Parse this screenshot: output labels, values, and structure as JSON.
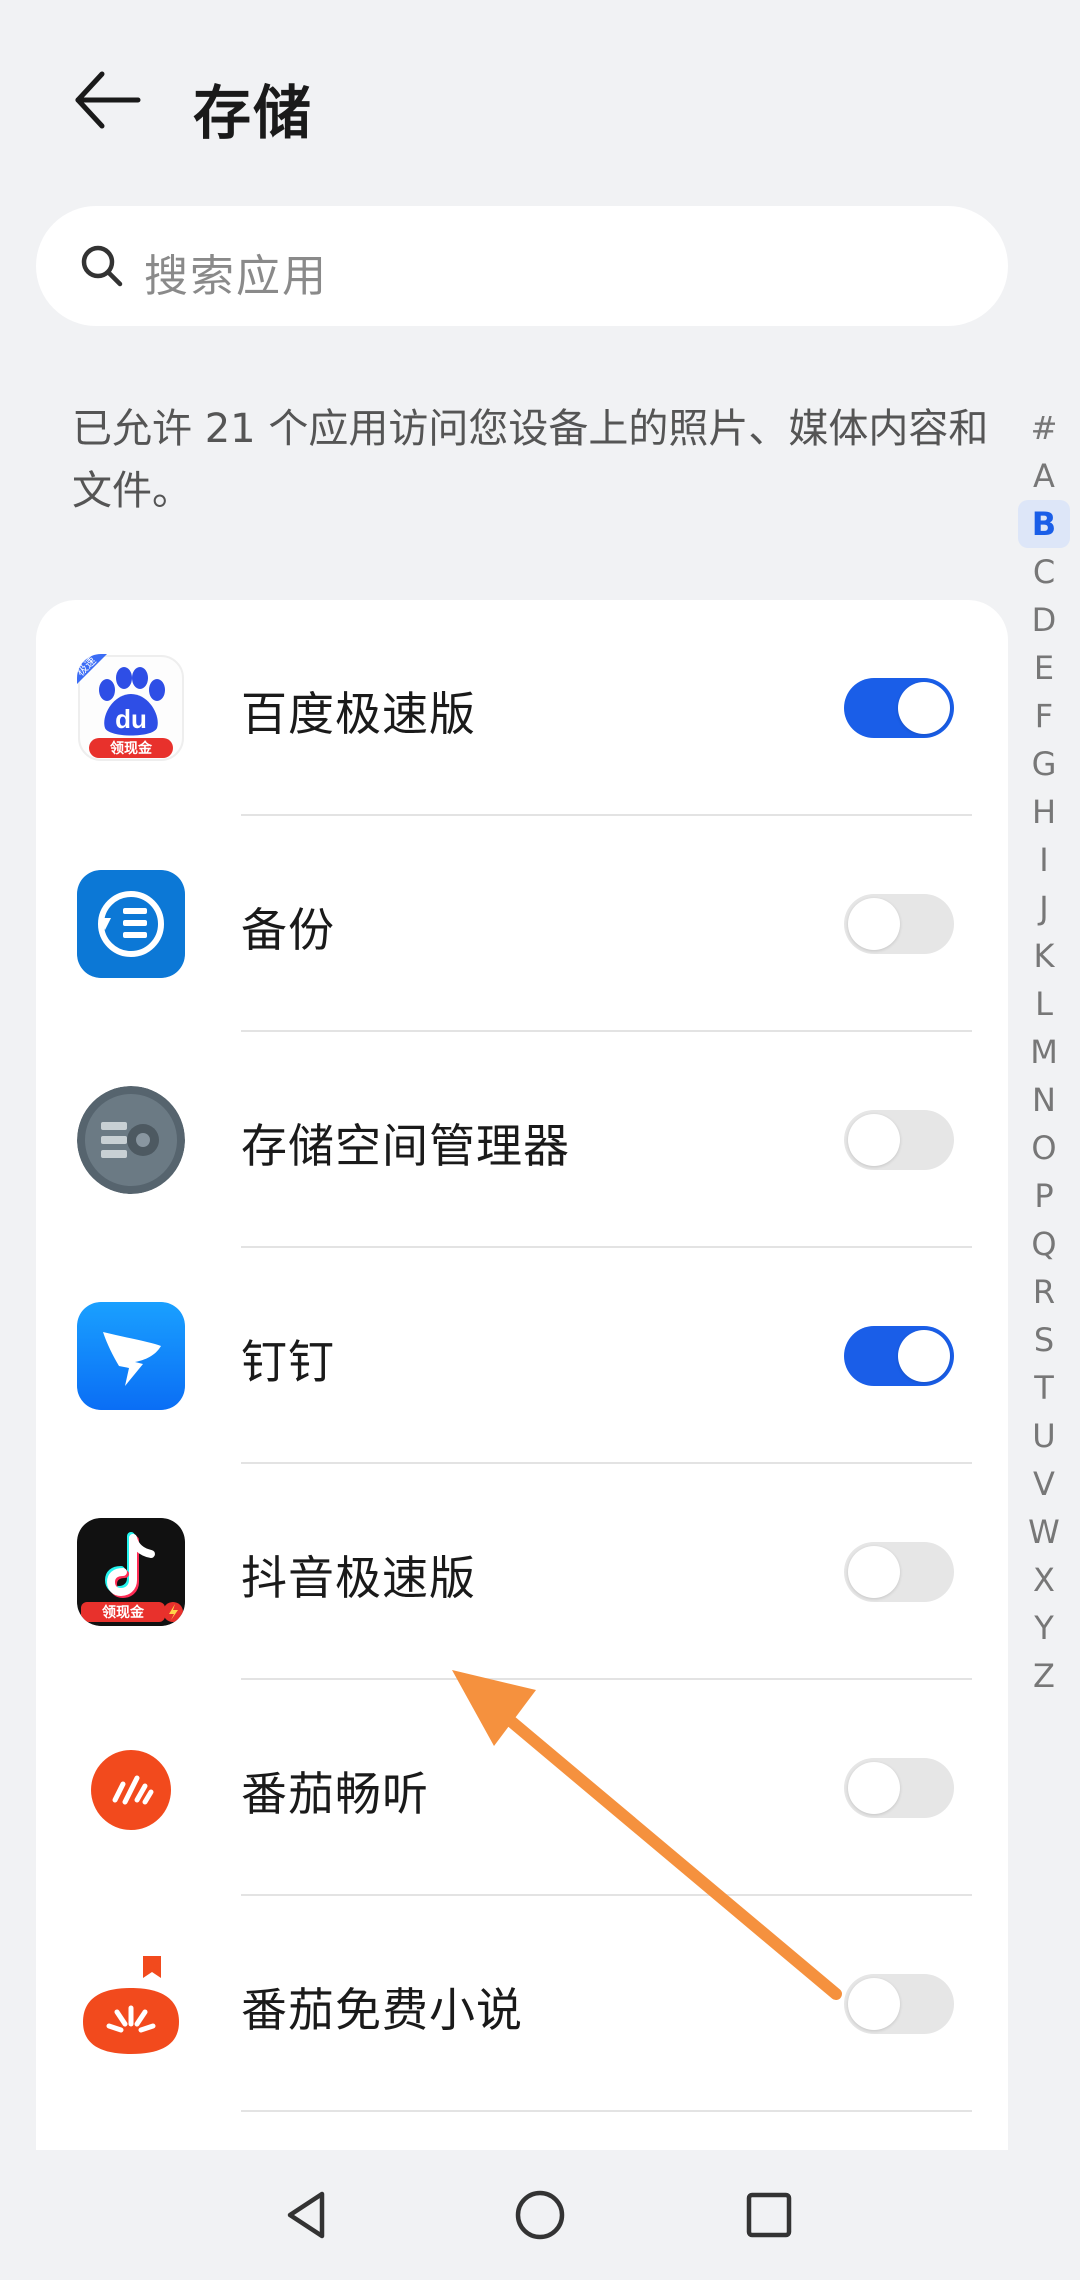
{
  "header": {
    "title": "存储",
    "back_icon": "arrow-left-icon"
  },
  "search": {
    "placeholder": "搜索应用",
    "icon": "search-icon"
  },
  "description": "已允许 21 个应用访问您设备上的照片、媒体内容和文件。",
  "alphabet": {
    "letters": [
      "#",
      "A",
      "B",
      "C",
      "D",
      "E",
      "F",
      "G",
      "H",
      "I",
      "J",
      "K",
      "L",
      "M",
      "N",
      "O",
      "P",
      "Q",
      "R",
      "S",
      "T",
      "U",
      "V",
      "W",
      "X",
      "Y",
      "Z"
    ],
    "active": "B"
  },
  "apps": [
    {
      "name": "百度极速版",
      "enabled": true,
      "badge_text": "极速",
      "banner_text": "领现金"
    },
    {
      "name": "备份",
      "enabled": false
    },
    {
      "name": "存储空间管理器",
      "enabled": false
    },
    {
      "name": "钉钉",
      "enabled": true
    },
    {
      "name": "抖音极速版",
      "enabled": false,
      "banner_text": "领现金"
    },
    {
      "name": "番茄畅听",
      "enabled": false
    },
    {
      "name": "番茄免费小说",
      "enabled": false
    }
  ],
  "colors": {
    "accent": "#1a5ee8",
    "background": "#f1f2f4",
    "arrow": "#f5913e"
  },
  "navbar": {
    "icons": [
      "back-triangle-icon",
      "home-circle-icon",
      "recents-square-icon"
    ]
  }
}
